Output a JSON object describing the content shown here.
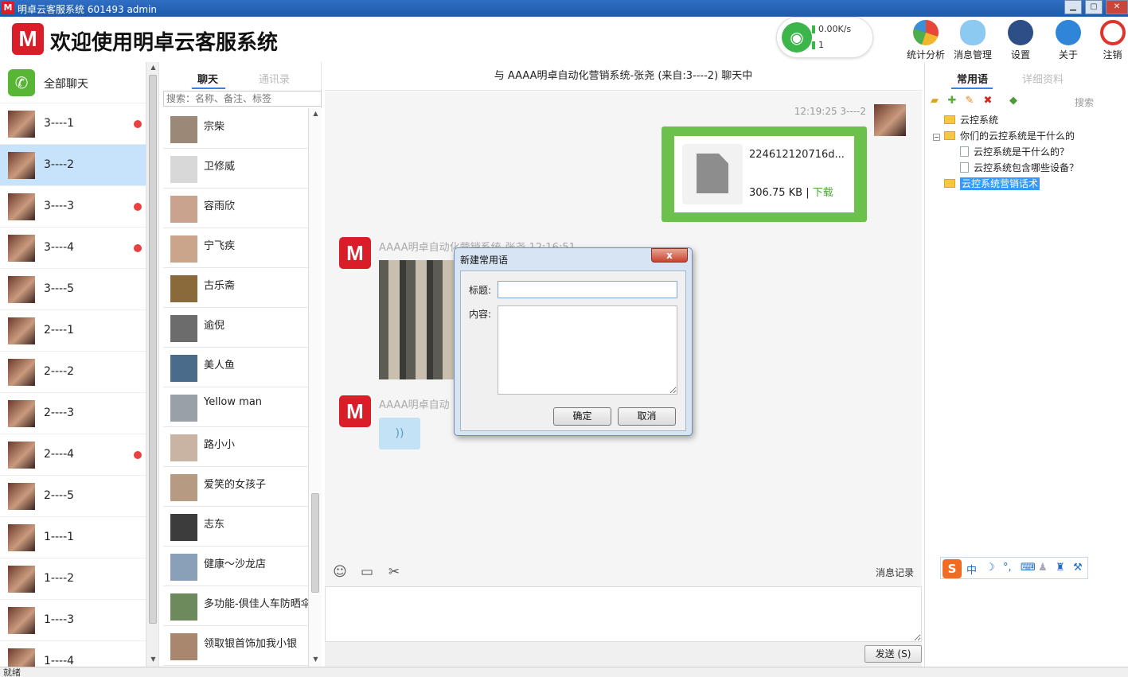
{
  "window": {
    "title": "明卓云客服系统  601493  admin",
    "icon_letter": "M",
    "min_glyph": "▁",
    "max_glyph": "▢",
    "close_glyph": "✕"
  },
  "header": {
    "logo_letter": "M",
    "welcome": "欢迎使用明卓云客服系统",
    "network": {
      "speed": "0.00K/s",
      "count": "1",
      "wifi_glyph": "◉"
    },
    "tools": [
      {
        "label": "统计分析",
        "icon": "pie-chart-icon",
        "color": "#f2a12b"
      },
      {
        "label": "消息管理",
        "icon": "chat-bubbles-icon",
        "color": "#5aaee8"
      },
      {
        "label": "设置",
        "icon": "gear-icon",
        "color": "#2d4e86"
      },
      {
        "label": "关于",
        "icon": "info-icon",
        "color": "#2f86d9"
      },
      {
        "label": "注销",
        "icon": "power-icon",
        "color": "#e0332e"
      }
    ]
  },
  "sessions": {
    "all_label": "全部聊天",
    "all_icon": "wechat-icon",
    "items": [
      {
        "name": "3----1",
        "unread": true
      },
      {
        "name": "3----2",
        "unread": false,
        "active": true
      },
      {
        "name": "3----3",
        "unread": true
      },
      {
        "name": "3----4",
        "unread": true
      },
      {
        "name": "3----5",
        "unread": false
      },
      {
        "name": "2----1",
        "unread": false
      },
      {
        "name": "2----2",
        "unread": false
      },
      {
        "name": "2----3",
        "unread": false
      },
      {
        "name": "2----4",
        "unread": true
      },
      {
        "name": "2----5",
        "unread": false
      },
      {
        "name": "1----1",
        "unread": false
      },
      {
        "name": "1----2",
        "unread": false
      },
      {
        "name": "1----3",
        "unread": false
      },
      {
        "name": "1----4",
        "unread": false
      }
    ]
  },
  "contacts": {
    "tab_chat": "聊天",
    "tab_contacts": "通讯录",
    "search_placeholder": "搜索：名称、备注、标签",
    "items": [
      {
        "name": "宗柴",
        "color": "#9b8877"
      },
      {
        "name": "卫修威",
        "color": "#d8d8d8"
      },
      {
        "name": "容雨欣",
        "color": "#c9a38d"
      },
      {
        "name": "宁飞疾",
        "color": "#caa58b"
      },
      {
        "name": "古乐斋",
        "color": "#8a6a3a"
      },
      {
        "name": "逾倪",
        "color": "#6c6c6c"
      },
      {
        "name": "美人鱼",
        "color": "#4a6c8a"
      },
      {
        "name": "Yellow man",
        "color": "#9aa0a8"
      },
      {
        "name": "路小小",
        "color": "#c9b3a2"
      },
      {
        "name": "爱笑的女孩子",
        "color": "#b69b82"
      },
      {
        "name": "志东",
        "color": "#3c3c3c"
      },
      {
        "name": "健康～沙龙店",
        "color": "#8aa0b8"
      },
      {
        "name": "多功能-倶佳人车防晒伞",
        "color": "#6c8a5c"
      },
      {
        "name": "领取银首饰加我小银",
        "color": "#a8876e"
      }
    ]
  },
  "chat": {
    "title": "与 AAAA明卓自动化营销系统-张尧 (来自:3----2) 聊天中",
    "my_time": "12:19:25 3----2",
    "file": {
      "name": "224612120716d...",
      "size": "306.75 KB",
      "sep": "|",
      "download": "下载"
    },
    "bot_sender": "AAAA明卓自动化营销系统-张尧 12:16:51",
    "bot_sender2": "AAAA明卓自动",
    "voice_glyph": "))",
    "toolbar": {
      "emoji": "☺",
      "folder": "▭",
      "scissors": "✂",
      "history": "消息记录"
    },
    "send_label": "发送 (S)"
  },
  "right": {
    "tab_phrases": "常用语",
    "tab_details": "详细资料",
    "search_label": "搜索",
    "toolbar_icons": [
      "add-folder-icon",
      "add-item-icon",
      "edit-icon",
      "delete-icon",
      "move-icon"
    ],
    "tree": [
      {
        "label": "云控系统",
        "type": "folder",
        "level": 0
      },
      {
        "label": "你们的云控系统是干什么的",
        "type": "folder",
        "level": 0,
        "expanded": true
      },
      {
        "label": "云控系统是干什么的？",
        "type": "page",
        "level": 1
      },
      {
        "label": "云控系统包含哪些设备？",
        "type": "page",
        "level": 1
      },
      {
        "label": "云控系统营销话术",
        "type": "folder",
        "level": 0,
        "selected": true
      }
    ],
    "ime": {
      "logo": "S",
      "mode": "中",
      "moon": "☽",
      "punct": "°,",
      "keyboard": "⌨",
      "user": "♟",
      "shirt": "♜",
      "wrench": "⚒"
    }
  },
  "status": {
    "text": "就绪"
  },
  "dialog": {
    "title": "新建常用语",
    "close_glyph": "x",
    "title_label": "标题:",
    "content_label": "内容:",
    "title_value": "",
    "content_value": "",
    "ok_label": "确定",
    "cancel_label": "取消"
  }
}
